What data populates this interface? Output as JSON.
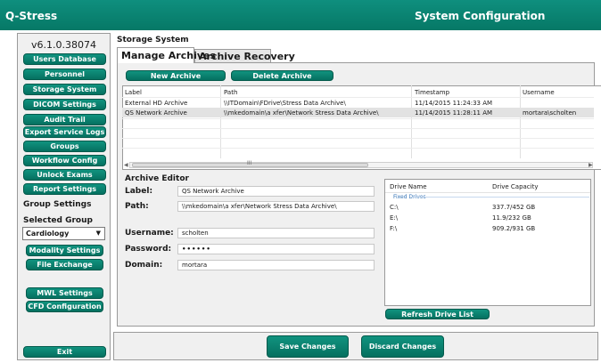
{
  "titlebar": {
    "app_title": "Q-Stress",
    "window_title": "System Configuration"
  },
  "sidebar": {
    "version": "v6.1.0.38074",
    "buttons": [
      "Users Database",
      "Personnel",
      "Storage System",
      "DICOM Settings",
      "Audit Trail",
      "Export Service Logs",
      "Groups",
      "Workflow Config",
      "Unlock Exams",
      "Report Settings"
    ],
    "group_settings_label": "Group Settings",
    "selected_group_label": "Selected Group",
    "selected_group_value": "Cardiology",
    "group_buttons": [
      "Modality Settings",
      "File Exchange"
    ],
    "extra_buttons": [
      "MWL Settings",
      "CFD Configuration"
    ],
    "exit_label": "Exit"
  },
  "storage": {
    "section_title": "Storage System",
    "tabs": [
      "Manage Archives",
      "Archive Recovery"
    ],
    "new_archive_label": "New Archive",
    "delete_archive_label": "Delete Archive",
    "table": {
      "columns": [
        "Label",
        "Path",
        "Timestamp",
        "Username"
      ],
      "rows": [
        [
          "External HD Archive",
          "\\\\ITDomain\\FDrive\\Stress Data Archive\\",
          "11/14/2015 11:24:33 AM",
          ""
        ],
        [
          "QS Network Archive",
          "\\\\mkedomain\\a xfer\\Network Stress Data Archive\\",
          "11/14/2015 11:28:11 AM",
          "mortara\\scholten"
        ]
      ],
      "selected_row": 1,
      "scroll_dots": "III"
    },
    "editor": {
      "title": "Archive Editor",
      "label_label": "Label:",
      "label_value": "QS Network Archive",
      "path_label": "Path:",
      "path_value": "\\\\mkedomain\\a xfer\\Network Stress Data Archive\\",
      "username_label": "Username:",
      "username_value": "scholten",
      "password_label": "Password:",
      "password_value": "••••••",
      "domain_label": "Domain:",
      "domain_value": "mortara"
    },
    "drives": {
      "columns": [
        "Drive Name",
        "Drive Capacity"
      ],
      "group": "Fixed Drives",
      "items": [
        [
          "C:\\",
          "337.7/452 GB"
        ],
        [
          "E:\\",
          "11.9/232 GB"
        ],
        [
          "F:\\",
          "909.2/931 GB"
        ]
      ],
      "refresh_label": "Refresh Drive List"
    }
  },
  "footer": {
    "save_label": "Save Changes",
    "discard_label": "Discard Changes"
  },
  "colors": {
    "accent": "#0b8572",
    "panel": "#f0f0f0",
    "border": "#9a9a9a"
  }
}
